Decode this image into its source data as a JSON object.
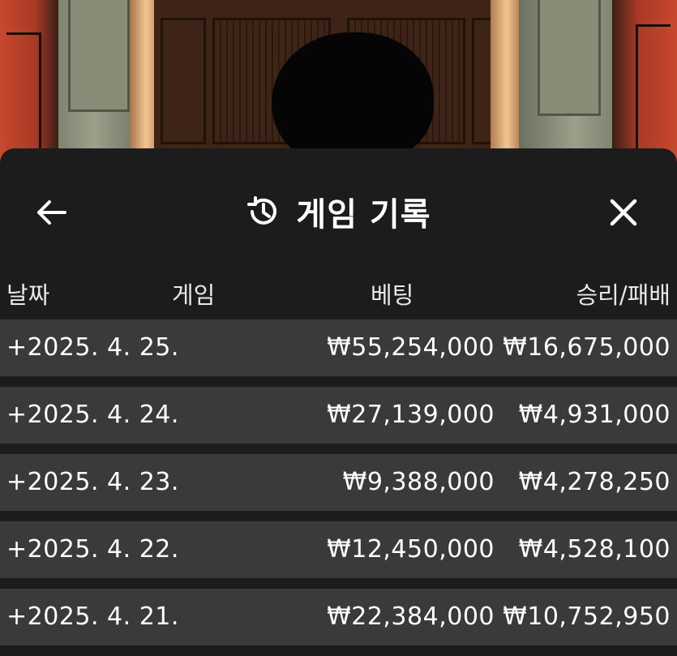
{
  "header": {
    "title": "게임 기록",
    "back_icon": "arrow-left-icon",
    "history_icon": "history-clock-icon",
    "close_icon": "close-icon"
  },
  "columns": {
    "date": "날짜",
    "game": "게임",
    "bet": "베팅",
    "winloss": "승리/패배"
  },
  "rows": [
    {
      "date": "+2025. 4. 25.",
      "game": "",
      "bet": "₩55,254,000",
      "winloss": "₩16,675,000"
    },
    {
      "date": "+2025. 4. 24.",
      "game": "",
      "bet": "₩27,139,000",
      "winloss": "₩4,931,000"
    },
    {
      "date": "+2025. 4. 23.",
      "game": "",
      "bet": "₩9,388,000",
      "winloss": "₩4,278,250"
    },
    {
      "date": "+2025. 4. 22.",
      "game": "",
      "bet": "₩12,450,000",
      "winloss": "₩4,528,100"
    },
    {
      "date": "+2025. 4. 21.",
      "game": "",
      "bet": "₩22,384,000",
      "winloss": "₩10,752,950"
    }
  ],
  "colors": {
    "sheet_background": "#1c1c1c",
    "row_background": "#3a3a3a",
    "text": "#ffffff"
  }
}
